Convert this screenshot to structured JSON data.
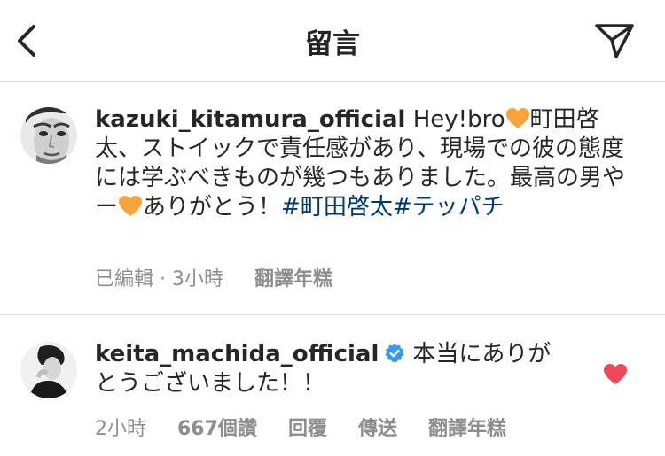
{
  "header": {
    "title": "留言"
  },
  "comments": [
    {
      "username": "kazuki_kitamura_official",
      "text_1": "Hey!bro",
      "text_2": "町田啓太、ストイックで責任感があり、現場での彼の態度には学ぶべきものが幾つもありました。最高の男やー",
      "text_3": "ありがとう！",
      "hashtags": "#町田啓太#テッパチ",
      "edited": "已編輯",
      "time": "3小時",
      "translate": "翻譯年糕",
      "emoji": "orange-heart",
      "accent_color": "#f9a33b"
    },
    {
      "username": "keita_machida_official",
      "text": "本当にありがとうございました！！",
      "time": "2小時",
      "likes": "667個讚",
      "reply": "回覆",
      "send": "傳送",
      "translate": "翻譯年糕",
      "heart_color": "#ed4956",
      "verified_color": "#3897f0"
    }
  ]
}
